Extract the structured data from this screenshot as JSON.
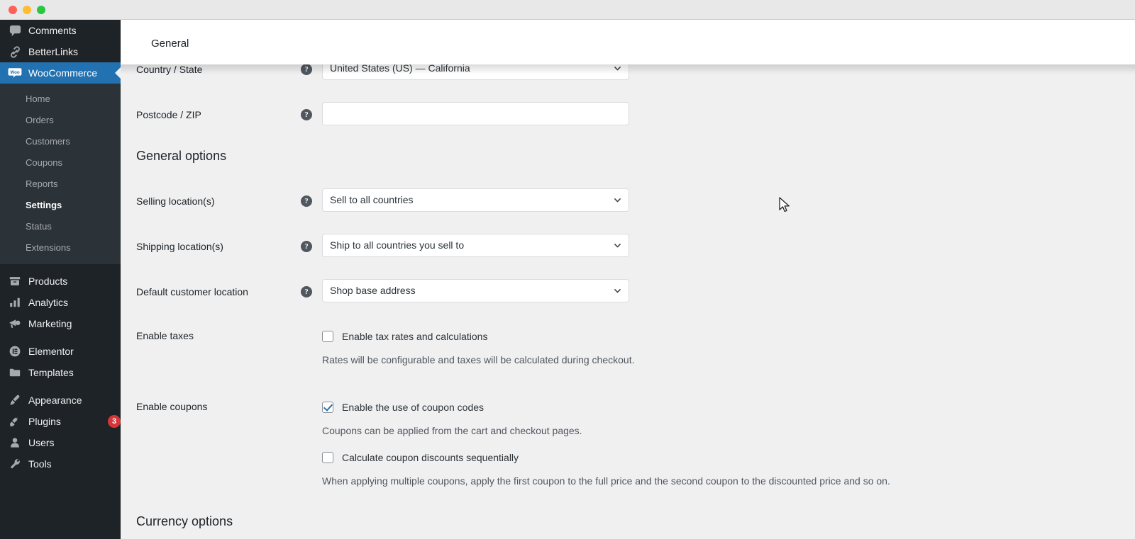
{
  "window": {
    "traffic_lights": [
      "close",
      "minimize",
      "zoom"
    ],
    "colors": {
      "close": "#ff5f57",
      "minimize": "#ffbd2e",
      "zoom": "#28c840",
      "titlebar_bg": "#e8e8e8"
    }
  },
  "sidebar": {
    "background": "#1d2327",
    "submenu_background": "#2c3338",
    "active_color": "#2271b1",
    "items": [
      {
        "label": "Comments",
        "icon": "comments-icon",
        "current": false,
        "badge": null
      },
      {
        "label": "BetterLinks",
        "icon": "link-icon",
        "current": false,
        "badge": null
      },
      {
        "label": "WooCommerce",
        "icon": "woocommerce-icon",
        "current": true,
        "badge": null
      },
      {
        "label": "Products",
        "icon": "products-icon",
        "current": false,
        "badge": null
      },
      {
        "label": "Analytics",
        "icon": "analytics-icon",
        "current": false,
        "badge": null
      },
      {
        "label": "Marketing",
        "icon": "marketing-megaphone-icon",
        "current": false,
        "badge": null
      },
      {
        "label": "Elementor",
        "icon": "elementor-icon",
        "current": false,
        "badge": null
      },
      {
        "label": "Templates",
        "icon": "templates-folder-icon",
        "current": false,
        "badge": null
      },
      {
        "label": "Appearance",
        "icon": "appearance-brush-icon",
        "current": false,
        "badge": null
      },
      {
        "label": "Plugins",
        "icon": "plugins-plug-icon",
        "current": false,
        "badge": "3"
      },
      {
        "label": "Users",
        "icon": "users-icon",
        "current": false,
        "badge": null
      },
      {
        "label": "Tools",
        "icon": "tools-icon",
        "current": false,
        "badge": null
      }
    ],
    "submenu": {
      "parent": "WooCommerce",
      "items": [
        {
          "label": "Home",
          "current": false
        },
        {
          "label": "Orders",
          "current": false
        },
        {
          "label": "Customers",
          "current": false
        },
        {
          "label": "Coupons",
          "current": false
        },
        {
          "label": "Reports",
          "current": false
        },
        {
          "label": "Settings",
          "current": true
        },
        {
          "label": "Status",
          "current": false
        },
        {
          "label": "Extensions",
          "current": false
        }
      ]
    }
  },
  "header": {
    "active_tab": "General"
  },
  "form": {
    "store_address_rows": [
      {
        "label": "Country / State",
        "help": "?",
        "control": "select",
        "value": "United States (US) — California"
      },
      {
        "label": "Postcode / ZIP",
        "help": "?",
        "control": "input",
        "value": "",
        "placeholder": ""
      }
    ],
    "general_options": {
      "title": "General options",
      "rows": [
        {
          "label": "Selling location(s)",
          "help": "?",
          "control": "select",
          "value": "Sell to all countries"
        },
        {
          "label": "Shipping location(s)",
          "help": "?",
          "control": "select",
          "value": "Ship to all countries you sell to"
        },
        {
          "label": "Default customer location",
          "help": "?",
          "control": "select",
          "value": "Shop base address"
        }
      ],
      "enable_taxes": {
        "label": "Enable taxes",
        "checkbox_label": "Enable tax rates and calculations",
        "checked": false,
        "description": "Rates will be configurable and taxes will be calculated during checkout."
      },
      "enable_coupons": {
        "label": "Enable coupons",
        "checkbox_label": "Enable the use of coupon codes",
        "checked": true,
        "description": "Coupons can be applied from the cart and checkout pages.",
        "sequential_checkbox_label": "Calculate coupon discounts sequentially",
        "sequential_checked": false,
        "sequential_description": "When applying multiple coupons, apply the first coupon to the full price and the second coupon to the discounted price and so on."
      }
    },
    "currency_options": {
      "title": "Currency options"
    }
  }
}
